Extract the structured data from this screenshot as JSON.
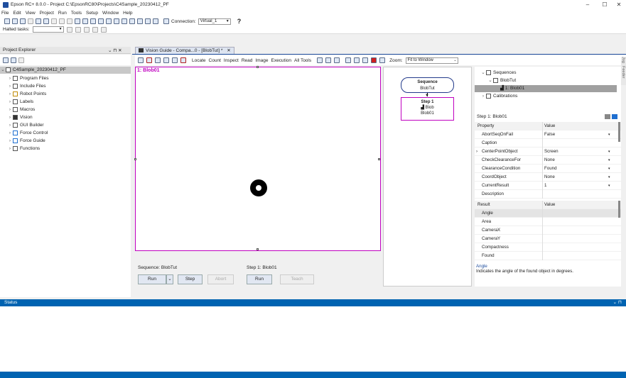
{
  "window": {
    "title": "Epson RC+ 8.0.0 - Project C:\\EpsonRC80\\Projects\\C4Sample_20230412_PF",
    "minimize": "–",
    "maximize": "☐",
    "close": "✕"
  },
  "menu": [
    "File",
    "Edit",
    "View",
    "Project",
    "Run",
    "Tools",
    "Setup",
    "Window",
    "Help"
  ],
  "toolbar": {
    "connection_label": "Connection:",
    "connection_value": "Virtual_1",
    "help_glyph": "?",
    "halted_label": "Halted tasks:"
  },
  "project_explorer": {
    "title": "Project Explorer",
    "pin_close": "⌄ ⊓ ✕",
    "root": "C4Sample_20230412_PF",
    "items": [
      {
        "label": "Program Files",
        "icon": "file-icon"
      },
      {
        "label": "Include Files",
        "icon": "file-icon"
      },
      {
        "label": "Robot Points",
        "icon": "points-icon"
      },
      {
        "label": "Labels",
        "icon": "labels-icon"
      },
      {
        "label": "Macros",
        "icon": "macros-icon"
      },
      {
        "label": "Vision",
        "icon": "camera-icon"
      },
      {
        "label": "GUI Builder",
        "icon": "gui-icon"
      },
      {
        "label": "Force Control",
        "icon": "force-icon"
      },
      {
        "label": "Force Guide",
        "icon": "force-icon"
      },
      {
        "label": "Functions",
        "icon": "functions-icon"
      }
    ]
  },
  "tab": {
    "label": "Vision Guide - Compa...0 - [BlobTut] *",
    "close": "✕"
  },
  "vision_toolbar": {
    "links": [
      "Locate",
      "Count",
      "Inspect",
      "Read",
      "Image",
      "Execution",
      "All Tools"
    ],
    "zoom_label": "Zoom:",
    "zoom_value": "Fit to Window"
  },
  "canvas": {
    "label": "1: Blob01"
  },
  "sequence_panel": {
    "sequence_label": "Sequence: BlobTut",
    "step_label": "Step 1: Blob01",
    "run": "Run",
    "step": "Step",
    "abort": "Abort",
    "run2": "Run",
    "teach": "Teach"
  },
  "flow": {
    "seq_title": "Sequence",
    "seq_name": "BlobTut",
    "step_title": "Step 1",
    "step_type": "Blob",
    "step_name": "Blob01"
  },
  "tree": {
    "sequences": "Sequences",
    "blobtut": "BlobTut",
    "blob01": "1: Blob01",
    "calibrations": "Calibrations"
  },
  "properties": {
    "header": "Step 1: Blob01",
    "col_property": "Property",
    "col_value": "Value",
    "rows": [
      {
        "name": "AbortSeqOnFail",
        "value": "False",
        "dd": "▾"
      },
      {
        "name": "Caption",
        "value": "",
        "dd": ""
      },
      {
        "name": "CenterPointObject",
        "value": "Screen",
        "dd": "▾"
      },
      {
        "name": "CheckClearanceFor",
        "value": "None",
        "dd": "▾"
      },
      {
        "name": "ClearanceCondition",
        "value": "Found",
        "dd": "▾"
      },
      {
        "name": "CoordObject",
        "value": "None",
        "dd": "▾"
      },
      {
        "name": "CurrentResult",
        "value": "1",
        "dd": "▾"
      },
      {
        "name": "Description",
        "value": "",
        "dd": ""
      }
    ],
    "col_result": "Result",
    "col_value2": "Value",
    "results": [
      "Angle",
      "Area",
      "CameraX",
      "CameraY",
      "Compactness",
      "Found"
    ],
    "desc_title": "Angle",
    "desc_text": "Indicates the angle of the found object in degrees."
  },
  "side_tabs": [
    "Jog",
    "Feeder"
  ],
  "status": {
    "title": "Status",
    "controls": "⌄ ⊓"
  }
}
